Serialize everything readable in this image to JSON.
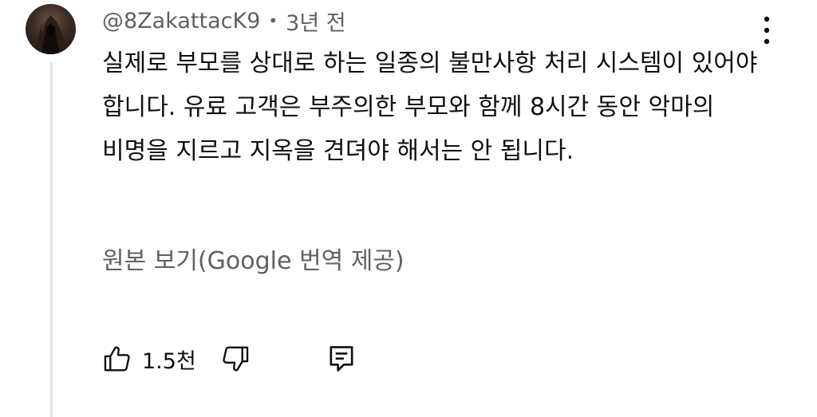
{
  "comment": {
    "author": "@8ZakattacK9",
    "separator": "•",
    "time": "3년 전",
    "text": "실제로 부모를 상대로 하는 일종의 불만사항 처리 시스템이 있어야 합니다. 유료 고객은 부주의한 부모와 함께 8시간 동안 악마의 비명을 지르고 지옥을 견뎌야 해서는 안 됩니다.",
    "translation_link": "원본 보기(Google 번역 제공)",
    "like_count": "1.5천"
  },
  "icons": {
    "avatar": "hooded-figure-avatar",
    "more": "more-vertical-icon",
    "like": "thumbs-up-icon",
    "dislike": "thumbs-down-icon",
    "reply": "reply-comment-icon"
  },
  "colors": {
    "primary_text": "#0f0f0f",
    "secondary_text": "#606060",
    "thread_line": "#e5e5e5"
  }
}
